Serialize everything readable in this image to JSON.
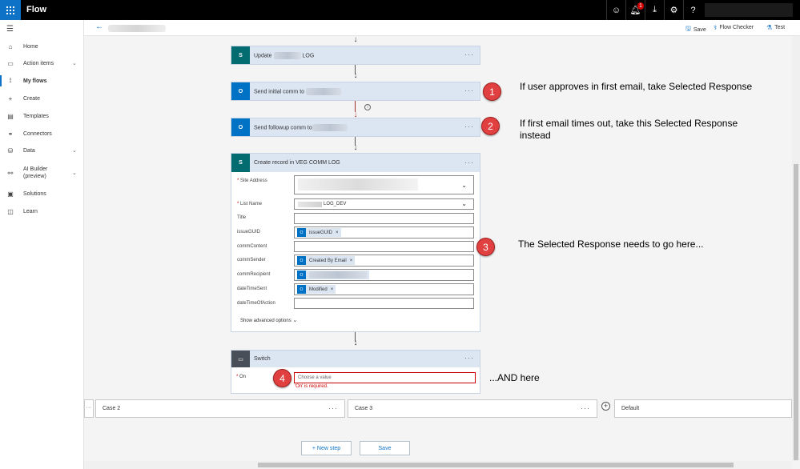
{
  "topbar": {
    "app_title": "Flow",
    "notification_count": "1",
    "icons": [
      "smiley-icon",
      "bell-icon",
      "download-icon",
      "gear-icon",
      "help-icon"
    ],
    "brand_color": "#0e72c7"
  },
  "sidebar": {
    "items": [
      {
        "label": "Home",
        "icon": "home-icon"
      },
      {
        "label": "Action items",
        "icon": "clipboard-icon",
        "expandable": true
      },
      {
        "label": "My flows",
        "icon": "flow-icon",
        "active": true
      },
      {
        "label": "Create",
        "icon": "plus-icon"
      },
      {
        "label": "Templates",
        "icon": "template-icon"
      },
      {
        "label": "Connectors",
        "icon": "connector-icon"
      },
      {
        "label": "Data",
        "icon": "database-icon",
        "expandable": true
      },
      {
        "label": "AI Builder (preview)",
        "icon": "ai-builder-icon",
        "expandable": true
      },
      {
        "label": "Solutions",
        "icon": "solutions-icon"
      },
      {
        "label": "Learn",
        "icon": "book-icon"
      }
    ]
  },
  "commandbar": {
    "save": "Save",
    "flow_checker": "Flow Checker",
    "test": "Test"
  },
  "steps": {
    "update": {
      "title_prefix": "Update",
      "title_suffix": "LOG",
      "more": "···"
    },
    "send_initial": {
      "title": "Send initial comm to",
      "more": "···"
    },
    "send_followup": {
      "title": "Send followup comm to",
      "more": "···"
    },
    "create_record": {
      "title": "Create record in VEG COMM LOG",
      "more": "···",
      "fields": [
        {
          "label": "Site Address",
          "required": true
        },
        {
          "label": "List Name",
          "required": true,
          "value_suffix": "LOG_DEV"
        },
        {
          "label": "Title"
        },
        {
          "label": "issueGUID",
          "token": "issueGUID"
        },
        {
          "label": "commContent"
        },
        {
          "label": "commSender",
          "token": "Created By Email"
        },
        {
          "label": "commRecipient"
        },
        {
          "label": "dateTimeSent",
          "token": "Modified"
        },
        {
          "label": "dateTimeOfAction"
        }
      ],
      "advanced": "Show advanced options"
    },
    "switch": {
      "title": "Switch",
      "more": "···",
      "on_label": "On",
      "placeholder": "Choose a value",
      "error": "'On' is required."
    }
  },
  "cases": [
    {
      "label": "Case 2",
      "more": "···"
    },
    {
      "label": "Case 3",
      "more": "···"
    },
    {
      "label": "Default"
    }
  ],
  "buttons": {
    "new_step": "+ New step",
    "save": "Save"
  },
  "annotations": [
    {
      "number": "1",
      "text": "If user approves in first email, take Selected Response"
    },
    {
      "number": "2",
      "text": "If first email times out, take this Selected Response instead"
    },
    {
      "number": "3",
      "text": "The Selected Response needs to go here..."
    },
    {
      "number": "4",
      "text": "...AND here"
    }
  ],
  "colors": {
    "card_header": "#dce6f3",
    "sharepoint_tile": "#036c70",
    "outlook_tile": "#0072c6",
    "annotation_red": "#e04040",
    "error_red": "#c00000"
  }
}
